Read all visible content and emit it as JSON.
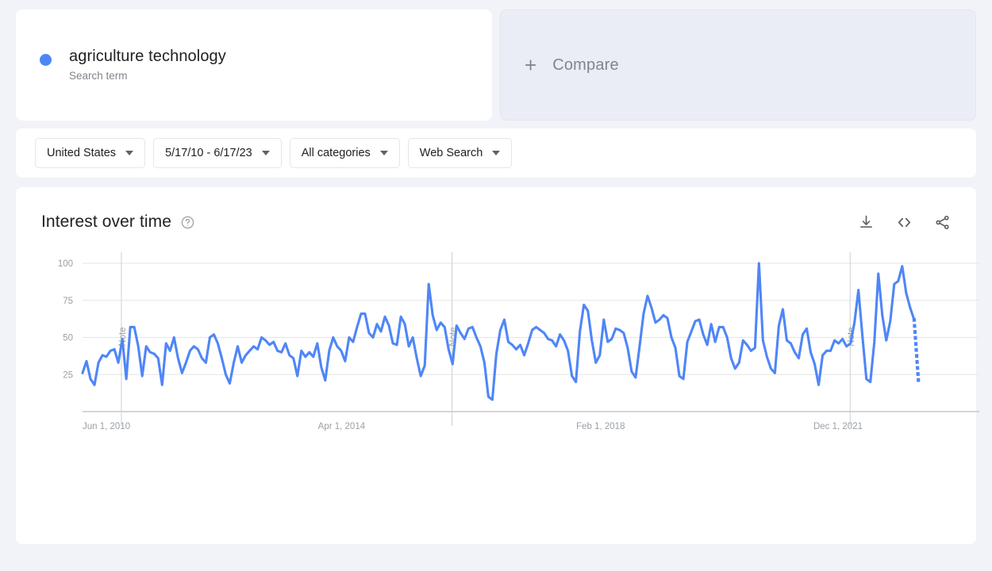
{
  "search_term": {
    "title": "agriculture technology",
    "subtitle": "Search term",
    "dot_color": "#4f86f7"
  },
  "compare": {
    "plus": "+",
    "label": "Compare"
  },
  "filters": [
    {
      "label": "United States",
      "name": "location-filter"
    },
    {
      "label": "5/17/10 - 6/17/23",
      "name": "date-range-filter"
    },
    {
      "label": "All categories",
      "name": "category-filter"
    },
    {
      "label": "Web Search",
      "name": "search-type-filter"
    }
  ],
  "chart_panel": {
    "title": "Interest over time",
    "help_icon": "help-circle-icon",
    "actions": [
      {
        "name": "download-icon",
        "label": "Download"
      },
      {
        "name": "embed-code-icon",
        "label": "Embed"
      },
      {
        "name": "share-icon",
        "label": "Share"
      }
    ]
  },
  "chart_data": {
    "type": "line",
    "title": "Interest over time",
    "xlabel": "",
    "ylabel": "",
    "ylim": [
      0,
      100
    ],
    "yticks": [
      25,
      50,
      75,
      100
    ],
    "ytick_labels": [
      "25",
      "50",
      "75",
      "100"
    ],
    "xtick_labels": [
      "Jun 1, 2010",
      "Apr 1, 2014",
      "Feb 1, 2018",
      "Dec 1, 2021"
    ],
    "xtick_positions": [
      0,
      0.3,
      0.6,
      0.875
    ],
    "grid": true,
    "legend_position": "top-card",
    "series_name": "agriculture technology",
    "line_color": "#4f86f7",
    "annotations": [
      {
        "label": "Note",
        "x_fraction": 0.045
      },
      {
        "label": "Note",
        "x_fraction": 0.428
      },
      {
        "label": "Note",
        "x_fraction": 0.889
      }
    ],
    "partial_tail": {
      "style": "dotted",
      "from_value": 62,
      "to_value": 20
    },
    "values": [
      26,
      34,
      22,
      18,
      33,
      38,
      37,
      41,
      42,
      33,
      49,
      22,
      57,
      57,
      44,
      24,
      44,
      40,
      39,
      36,
      18,
      46,
      41,
      50,
      36,
      26,
      33,
      41,
      44,
      42,
      36,
      33,
      50,
      52,
      46,
      36,
      25,
      19,
      33,
      44,
      33,
      38,
      41,
      44,
      42,
      50,
      48,
      45,
      47,
      41,
      40,
      46,
      38,
      36,
      24,
      41,
      37,
      40,
      37,
      46,
      30,
      21,
      41,
      50,
      44,
      41,
      34,
      50,
      47,
      57,
      66,
      66,
      53,
      50,
      59,
      54,
      64,
      58,
      46,
      45,
      64,
      59,
      44,
      50,
      36,
      24,
      31,
      86,
      65,
      55,
      60,
      57,
      42,
      32,
      58,
      53,
      49,
      56,
      57,
      50,
      44,
      33,
      10,
      8,
      39,
      55,
      62,
      47,
      45,
      42,
      45,
      38,
      46,
      55,
      57,
      55,
      53,
      49,
      48,
      44,
      52,
      48,
      41,
      24,
      20,
      54,
      72,
      68,
      48,
      33,
      38,
      62,
      47,
      49,
      56,
      55,
      53,
      43,
      27,
      23,
      44,
      66,
      78,
      70,
      60,
      62,
      65,
      63,
      50,
      43,
      24,
      22,
      47,
      54,
      61,
      62,
      52,
      45,
      59,
      47,
      57,
      57,
      50,
      36,
      29,
      33,
      48,
      45,
      41,
      43,
      100,
      48,
      37,
      29,
      26,
      58,
      69,
      48,
      46,
      40,
      36,
      52,
      56,
      40,
      32,
      18,
      38,
      41,
      41,
      48,
      46,
      49,
      44,
      46,
      60,
      82,
      51,
      22,
      20,
      47,
      93,
      65,
      48,
      61,
      86,
      88,
      98,
      80,
      70,
      62
    ]
  }
}
